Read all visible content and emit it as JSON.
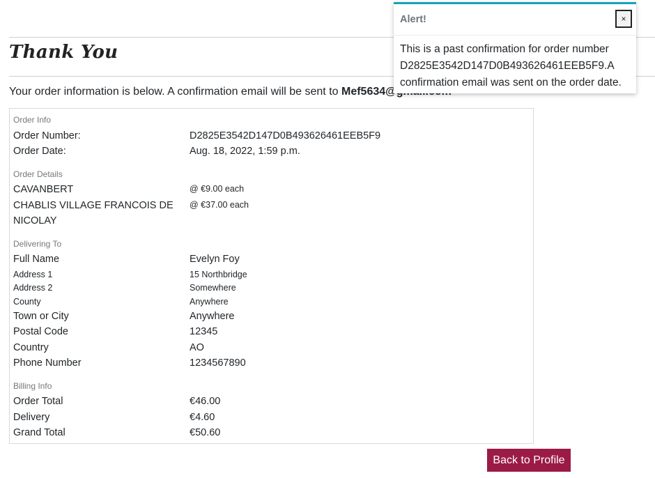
{
  "page": {
    "title": "Thank You",
    "intro_text": "Your order information is below. A confirmation email will be sent to ",
    "email": "Mef5634@gmail.com"
  },
  "order_info": {
    "heading": "Order Info",
    "order_number_label": "Order Number:",
    "order_number": "D2825E3542D147D0B493626461EEB5F9",
    "order_date_label": "Order Date:",
    "order_date": "Aug. 18, 2022, 1:59 p.m."
  },
  "order_details": {
    "heading": "Order Details",
    "items": [
      {
        "name": "CAVANBERT",
        "price": "@ €9.00 each"
      },
      {
        "name": "CHABLIS VILLAGE FRANCOIS DE NICOLAY",
        "price": "@ €37.00 each"
      }
    ]
  },
  "delivering_to": {
    "heading": "Delivering To",
    "full_name_label": "Full Name",
    "full_name": "Evelyn Foy",
    "address1_label": "Address 1",
    "address1": "15 Northbridge",
    "address2_label": "Address 2",
    "address2": "Somewhere",
    "county_label": "County",
    "county": "Anywhere",
    "town_label": "Town or City",
    "town": "Anywhere",
    "postal_label": "Postal Code",
    "postal": "12345",
    "country_label": "Country",
    "country": "AO",
    "phone_label": "Phone Number",
    "phone": "1234567890"
  },
  "billing": {
    "heading": "Billing Info",
    "order_total_label": "Order Total",
    "order_total": "€46.00",
    "delivery_label": "Delivery",
    "delivery": "€4.60",
    "grand_total_label": "Grand Total",
    "grand_total": "€50.60"
  },
  "actions": {
    "back_label": "Back to Profile"
  },
  "toast": {
    "title": "Alert!",
    "close_glyph": "×",
    "message": "This is a past confirmation for order number D2825E3542D147D0B493626461EEB5F9.A confirmation email was sent on the order date.",
    "accent_color": "#17a2b8"
  },
  "colors": {
    "button_bg": "#9b1b46",
    "text": "#212529",
    "muted": "#777777"
  }
}
